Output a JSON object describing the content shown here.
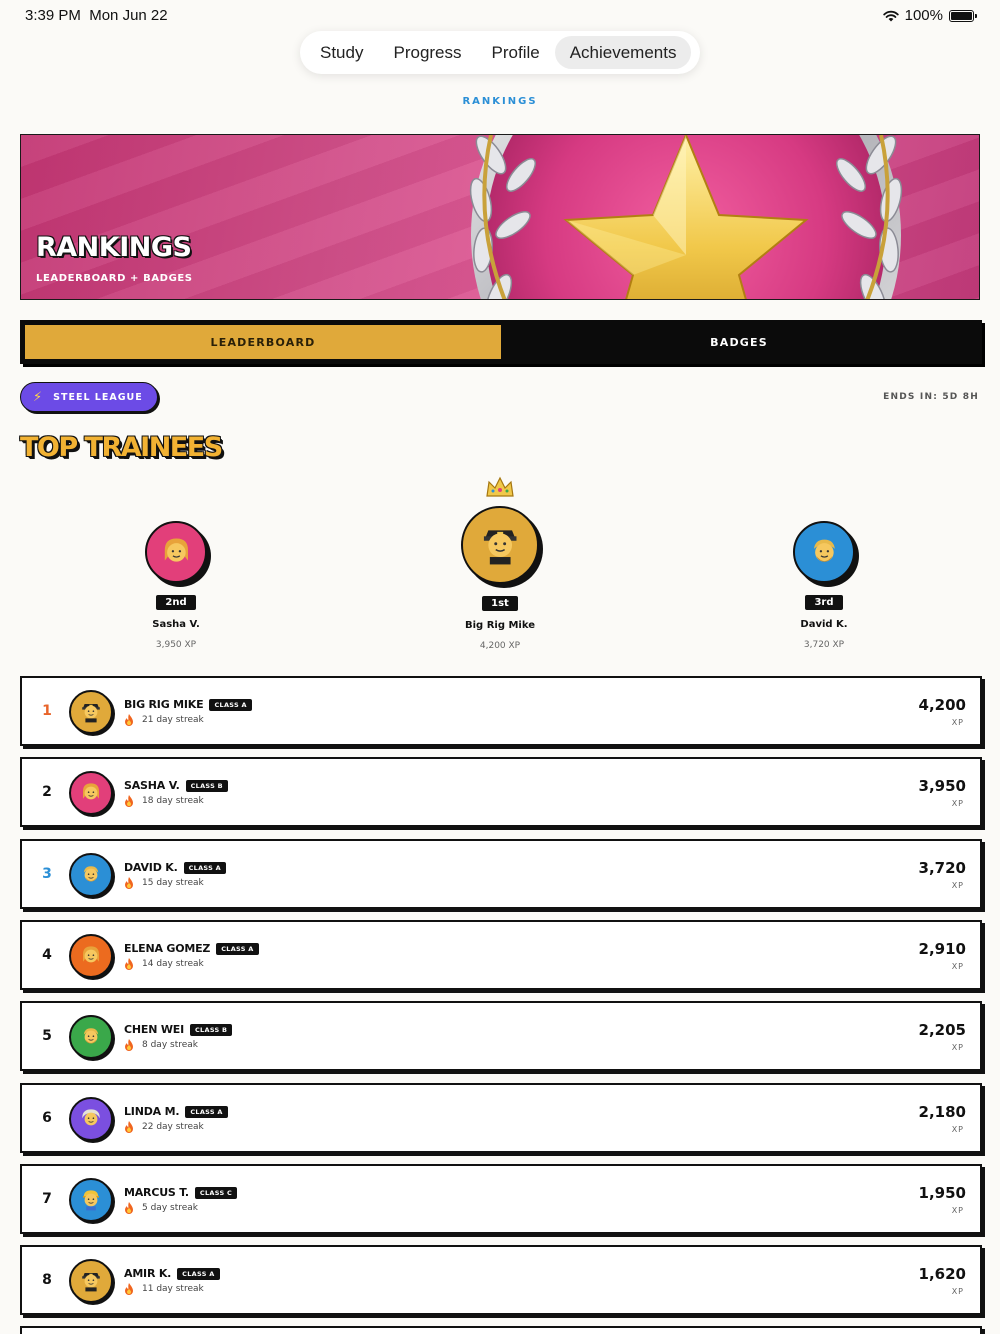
{
  "status_bar": {
    "time": "3:39 PM",
    "date": "Mon Jun 22",
    "battery": "100%"
  },
  "nav": {
    "tabs": [
      "Study",
      "Progress",
      "Profile",
      "Achievements"
    ],
    "active": "Achievements"
  },
  "section_kicker": "RANKINGS",
  "hero": {
    "title": "RANKINGS",
    "subtitle": "LEADERBOARD + BADGES"
  },
  "segmented": {
    "leaderboard": "LEADERBOARD",
    "badges": "BADGES",
    "active": "LEADERBOARD"
  },
  "league": {
    "icon": "bolt-icon",
    "label": "STEEL LEAGUE",
    "ends": "ENDS IN: 5D 8H"
  },
  "top_title": "TOP TRAINEES",
  "podium": [
    {
      "rank": "2nd",
      "name": "Sasha V.",
      "xp": "3,950 XP",
      "color": "#e23f7a",
      "face": "woman"
    },
    {
      "rank": "1st",
      "name": "Big Rig Mike",
      "xp": "4,200 XP",
      "color": "#e0a93a",
      "face": "pilot"
    },
    {
      "rank": "3rd",
      "name": "David K.",
      "xp": "3,720 XP",
      "color": "#2b8fd6",
      "face": "man"
    }
  ],
  "leaderboard": [
    {
      "rank": "1",
      "name": "BIG RIG MIKE",
      "class": "CLASS A",
      "streak": "21 day streak",
      "xp": "4,200",
      "unit": "XP",
      "color": "#e0a93a",
      "rank_color": "#e8642a",
      "face": "pilot"
    },
    {
      "rank": "2",
      "name": "SASHA V.",
      "class": "CLASS B",
      "streak": "18 day streak",
      "xp": "3,950",
      "unit": "XP",
      "color": "#e23f7a",
      "rank_color": "#111",
      "face": "woman"
    },
    {
      "rank": "3",
      "name": "DAVID K.",
      "class": "CLASS A",
      "streak": "15 day streak",
      "xp": "3,720",
      "unit": "XP",
      "color": "#2b8fd6",
      "rank_color": "#2b8fd6",
      "face": "man"
    },
    {
      "rank": "4",
      "name": "ELENA GOMEZ",
      "class": "CLASS A",
      "streak": "14 day streak",
      "xp": "2,910",
      "unit": "XP",
      "color": "#ec6b1f",
      "rank_color": "#111",
      "face": "woman"
    },
    {
      "rank": "5",
      "name": "CHEN WEI",
      "class": "CLASS B",
      "streak": "8 day streak",
      "xp": "2,205",
      "unit": "XP",
      "color": "#3aa84a",
      "rank_color": "#111",
      "face": "man"
    },
    {
      "rank": "6",
      "name": "LINDA M.",
      "class": "CLASS A",
      "streak": "22 day streak",
      "xp": "2,180",
      "unit": "XP",
      "color": "#7b4fe0",
      "rank_color": "#111",
      "face": "elder"
    },
    {
      "rank": "7",
      "name": "MARCUS T.",
      "class": "CLASS C",
      "streak": "5 day streak",
      "xp": "1,950",
      "unit": "XP",
      "color": "#2b8fd6",
      "rank_color": "#111",
      "face": "worker"
    },
    {
      "rank": "8",
      "name": "AMIR K.",
      "class": "CLASS A",
      "streak": "11 day streak",
      "xp": "1,620",
      "unit": "XP",
      "color": "#e0a93a",
      "rank_color": "#111",
      "face": "pilot"
    }
  ]
}
